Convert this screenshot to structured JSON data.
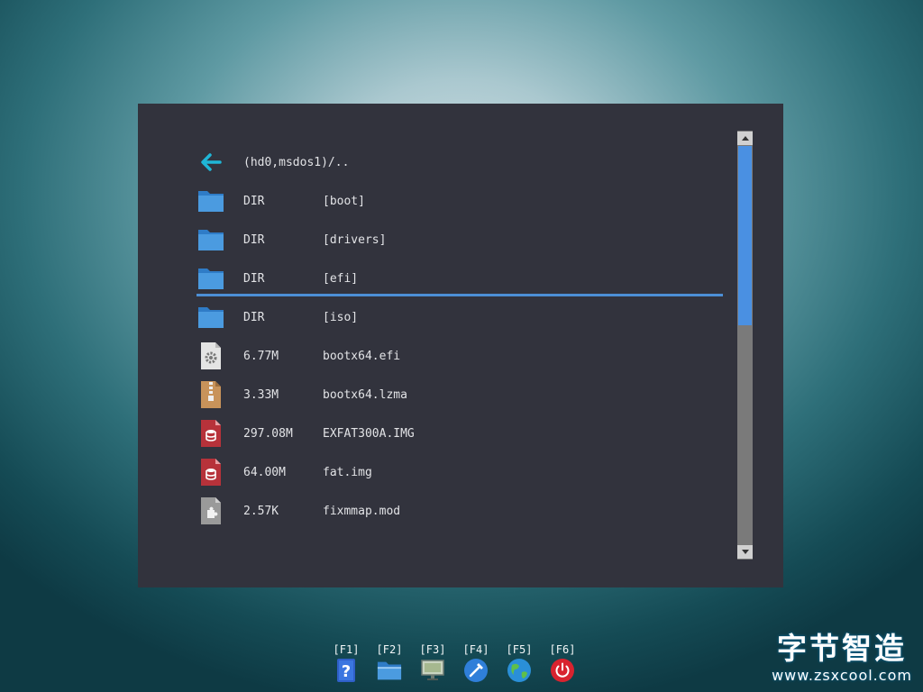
{
  "browser": {
    "parent": {
      "path": "(hd0,msdos1)/..",
      "icon": "back-arrow-icon"
    },
    "entries": [
      {
        "size": "DIR",
        "name": "[boot]",
        "icon": "folder-icon"
      },
      {
        "size": "DIR",
        "name": "[drivers]",
        "icon": "folder-icon"
      },
      {
        "size": "DIR",
        "name": "[efi]",
        "icon": "folder-icon"
      },
      {
        "size": "DIR",
        "name": "[iso]",
        "icon": "folder-icon"
      },
      {
        "size": "6.77M",
        "name": "bootx64.efi",
        "icon": "gear-file-icon"
      },
      {
        "size": "3.33M",
        "name": "bootx64.lzma",
        "icon": "archive-file-icon"
      },
      {
        "size": "297.08M",
        "name": "EXFAT300A.IMG",
        "icon": "disk-image-file-icon"
      },
      {
        "size": "64.00M",
        "name": "fat.img",
        "icon": "disk-image-file-icon"
      },
      {
        "size": "2.57K",
        "name": "fixmmap.mod",
        "icon": "module-file-icon"
      }
    ],
    "scroll_fraction_visible": 0.45
  },
  "function_keys": [
    {
      "key": "[F1]",
      "icon": "help-icon"
    },
    {
      "key": "[F2]",
      "icon": "folder-icon"
    },
    {
      "key": "[F3]",
      "icon": "display-icon"
    },
    {
      "key": "[F4]",
      "icon": "tools-icon"
    },
    {
      "key": "[F5]",
      "icon": "globe-icon"
    },
    {
      "key": "[F6]",
      "icon": "power-icon"
    }
  ],
  "watermark": {
    "title": "字节智造",
    "url": "www.zsxcool.com"
  },
  "colors": {
    "panel": "#32333d",
    "accent": "#4c8fd6",
    "back_arrow": "#1fb6d6",
    "folder": "#3d8ed8"
  }
}
